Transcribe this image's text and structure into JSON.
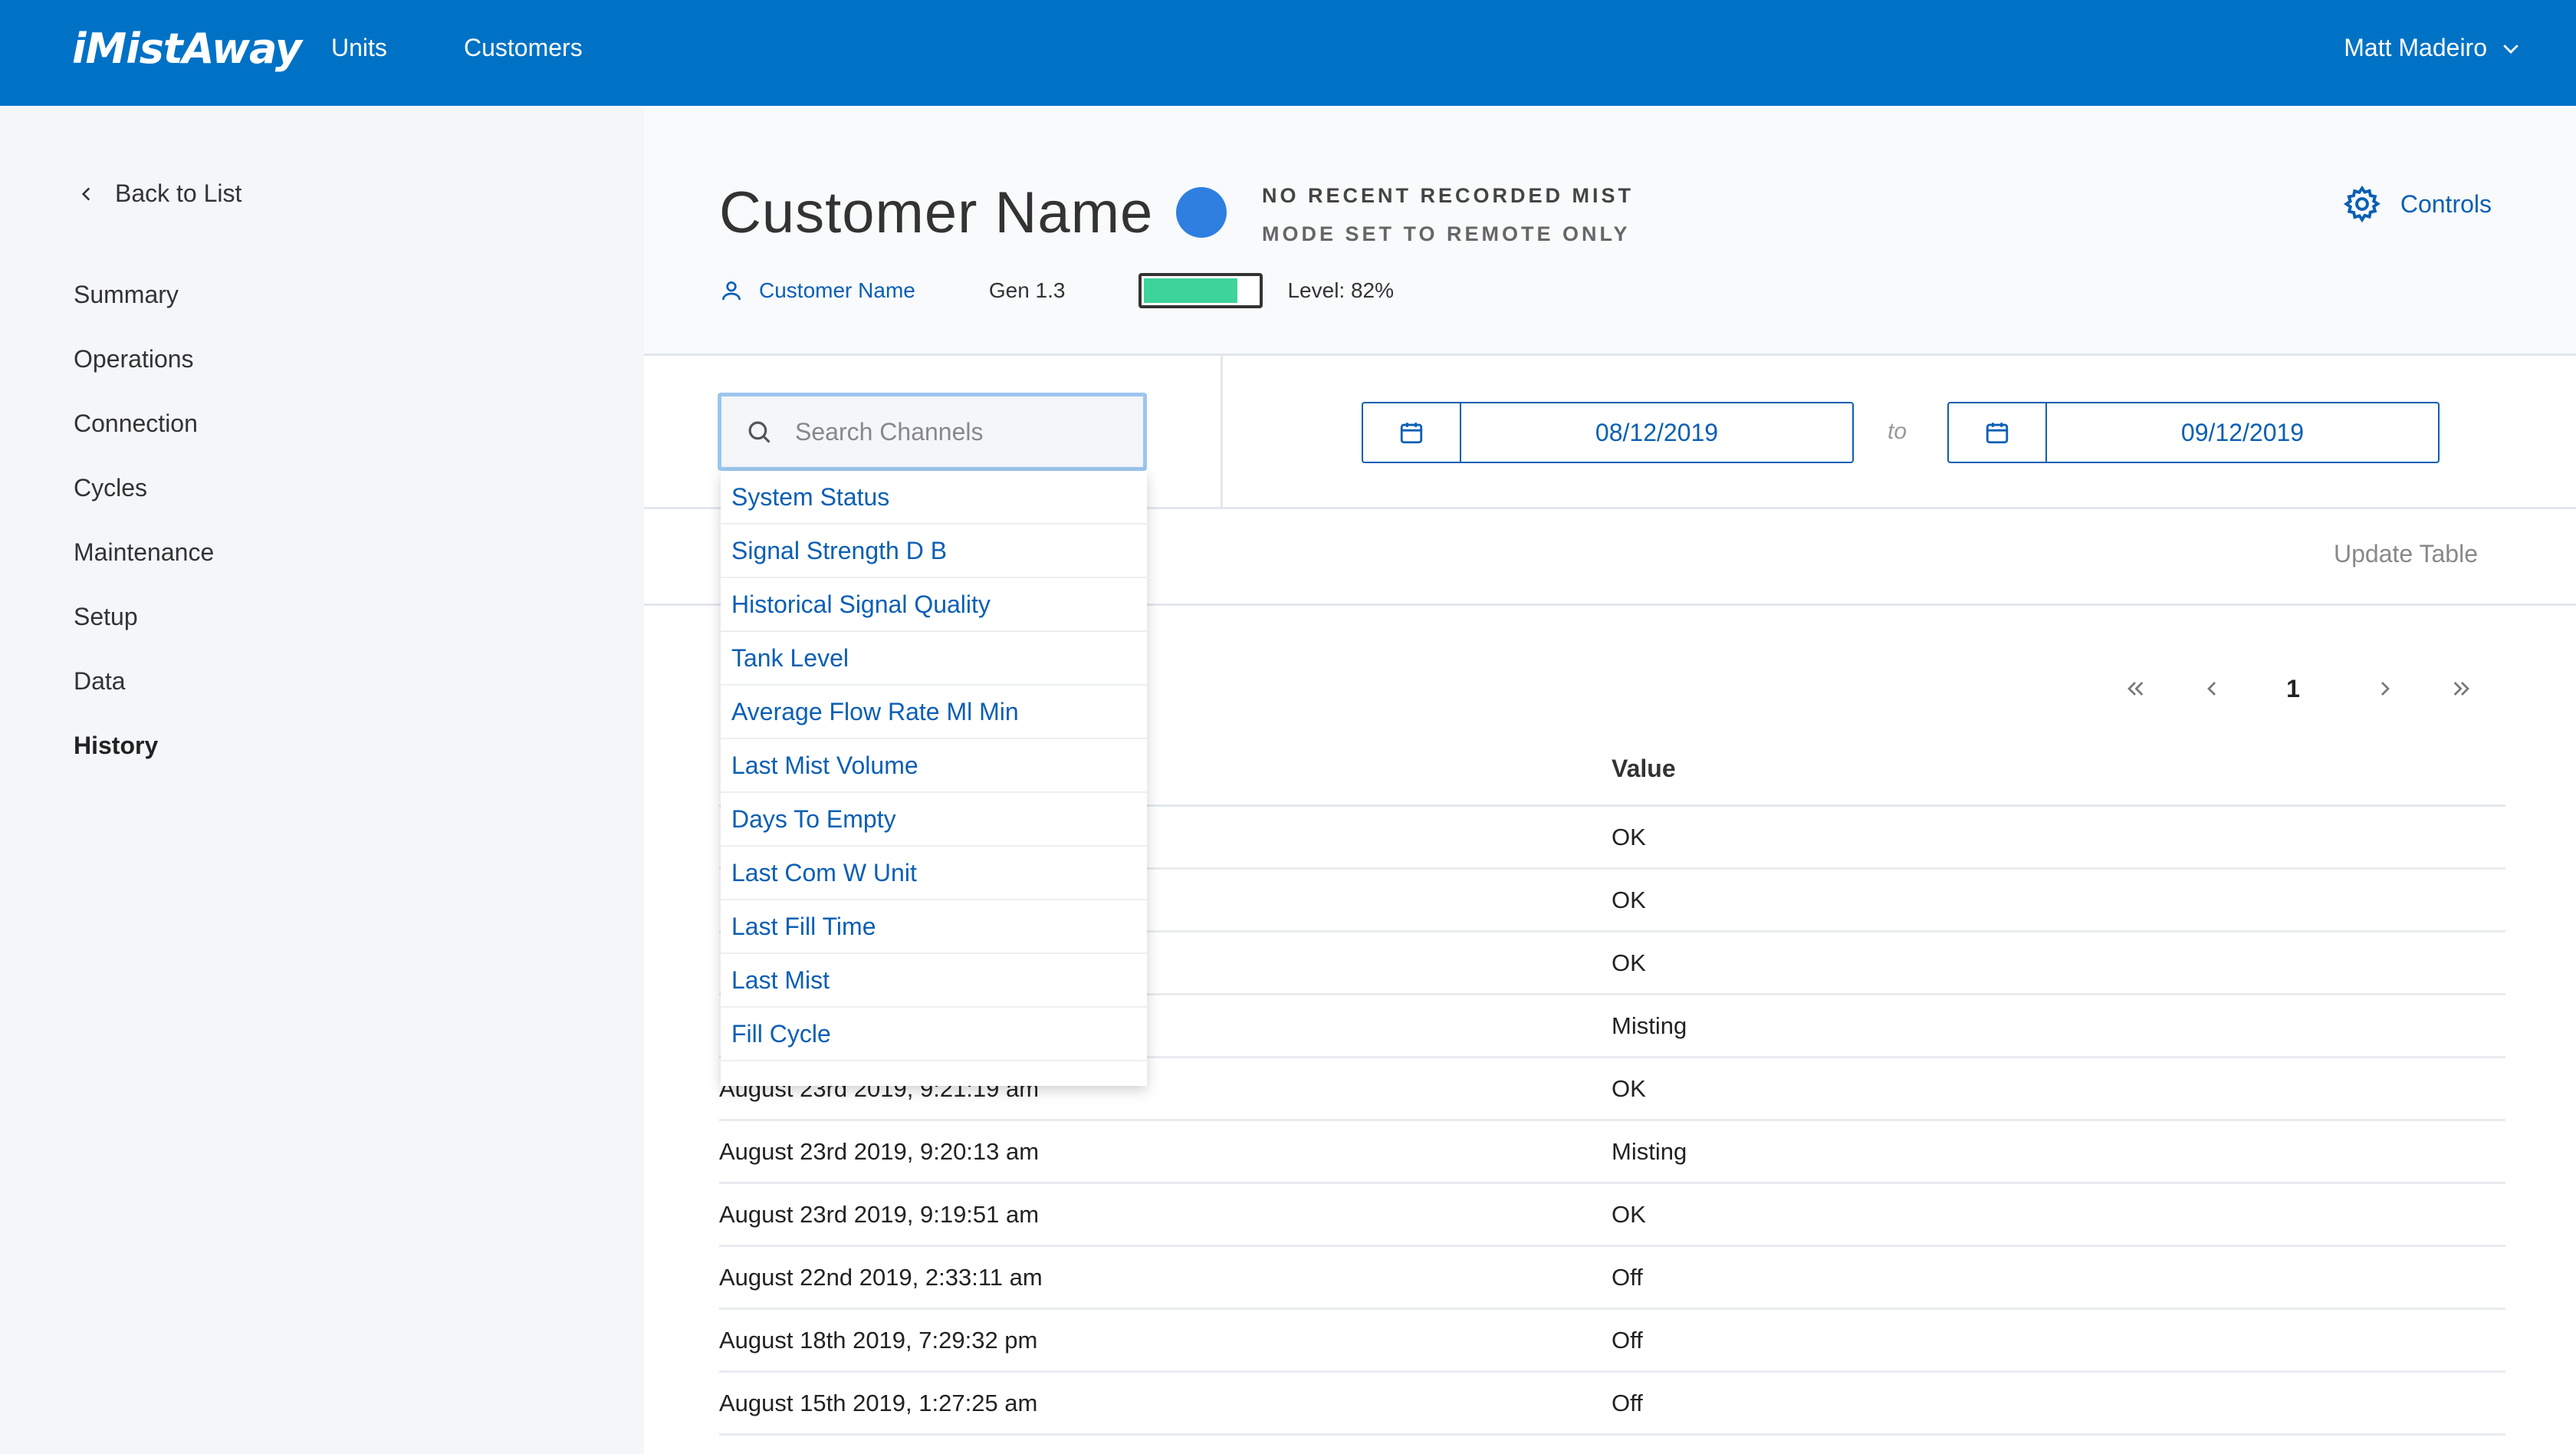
{
  "brand": {
    "logo": "iMistAway"
  },
  "topnav": {
    "links": [
      "Units",
      "Customers"
    ],
    "user": "Matt Madeiro"
  },
  "sidebar": {
    "back": "Back to List",
    "items": [
      "Summary",
      "Operations",
      "Connection",
      "Cycles",
      "Maintenance",
      "Setup",
      "Data",
      "History"
    ],
    "active": "History"
  },
  "header": {
    "title": "Customer Name",
    "status_line1": "NO RECENT RECORDED MIST",
    "status_line2": "MODE SET TO REMOTE ONLY",
    "status_color": "#2e7fe0",
    "controls_label": "Controls",
    "customer_link": "Customer Name",
    "gen": "Gen 1.3",
    "level_fraction": 0.82,
    "level_text": "Level: 82%"
  },
  "filters": {
    "search_placeholder": "Search Channels",
    "date_from": "08/12/2019",
    "date_to": "09/12/2019",
    "to_label": "to",
    "update_label": "Update Table"
  },
  "channels": [
    "System Status",
    "Signal Strength D B",
    "Historical Signal Quality",
    "Tank Level",
    "Average Flow Rate Ml Min",
    "Last Mist Volume",
    "Days To Empty",
    "Last Com W Unit",
    "Last Fill Time",
    "Last Mist",
    "Fill Cycle"
  ],
  "pagination": {
    "current": "1"
  },
  "table": {
    "value_header": "Value",
    "rows": [
      {
        "time": "",
        "value": "OK"
      },
      {
        "time": "",
        "value": "OK"
      },
      {
        "time": "",
        "value": "OK"
      },
      {
        "time": "",
        "value": "Misting"
      },
      {
        "time": "August 23rd 2019, 9:21:19 am",
        "value": "OK"
      },
      {
        "time": "August 23rd 2019, 9:20:13 am",
        "value": "Misting"
      },
      {
        "time": "August 23rd 2019, 9:19:51 am",
        "value": "OK"
      },
      {
        "time": "August 22nd 2019, 2:33:11 am",
        "value": "Off"
      },
      {
        "time": "August 18th 2019, 7:29:32 pm",
        "value": "Off"
      },
      {
        "time": "August 15th 2019, 1:27:25 am",
        "value": "Off"
      }
    ]
  }
}
